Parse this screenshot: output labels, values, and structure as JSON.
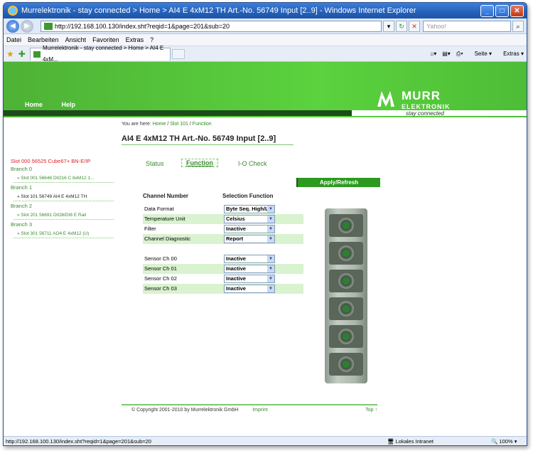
{
  "window": {
    "title": "Murrelektronik - stay connected > Home > AI4 E 4xM12 TH Art.-No. 56749 Input [2..9] - Windows Internet Explorer",
    "url": "http://192.168.100.130/index.sht?reqid=1&page=201&sub=20",
    "search_placeholder": "Yahoo!",
    "tab_title": "Murrelektronik - stay connected > Home > AI4 E 4xM...",
    "status_url": "http://192.168.100.130/index.sht?reqid=1&page=201&sub=20",
    "zone": "Lokales Intranet",
    "zoom": "100%"
  },
  "menu": [
    "Datei",
    "Bearbeiten",
    "Ansicht",
    "Favoriten",
    "Extras",
    "?"
  ],
  "commands": {
    "page": "Seite",
    "extras": "Extras"
  },
  "site": {
    "nav": [
      "Home",
      "Help"
    ],
    "logo_top": "MURR",
    "logo_bottom": "ELEKTRONIK",
    "slogan": "stay connected"
  },
  "breadcrumb": {
    "prefix": "You are here:",
    "home": "Home",
    "slot": "Slot 101",
    "page": "Function"
  },
  "page_title": "AI4 E 4xM12 TH Art.-No. 56749 Input [2..9]",
  "sidebar": {
    "slot0": "Slot 000 56525 Cube67+ BN-E/IP",
    "groups": [
      {
        "branch": "Branch 0",
        "item": "Slot 001 56646 DIO16 C 8xM12 1..."
      },
      {
        "branch": "Branch 1",
        "item": "Slot 101 56749 AI4 E 4xM12 TH"
      },
      {
        "branch": "Branch 2",
        "item": "Slot 201 56691 DIO8/DI8 E Rail"
      },
      {
        "branch": "Branch 3",
        "item": "Slot 301 56711 AO4 E 4xM12 (U)"
      }
    ]
  },
  "tabs": {
    "status": "Status",
    "function": "Function",
    "io_check": "I-O Check"
  },
  "apply_button": "Apply/Refresh",
  "table": {
    "col_channel": "Channel Number",
    "col_selection": "Selection Function",
    "rows": [
      {
        "label": "Data Format",
        "value": "Byte Seq. High/L"
      },
      {
        "label": "Temperature Unit",
        "value": "Celsius"
      },
      {
        "label": "Filter",
        "value": "Inactive"
      },
      {
        "label": "Channel Diagnostic",
        "value": "Report"
      },
      {
        "label": "Sensor Ch 00",
        "value": "Inactive"
      },
      {
        "label": "Sensor Ch 01",
        "value": "Inactive"
      },
      {
        "label": "Sensor Ch 02",
        "value": "Inactive"
      },
      {
        "label": "Sensor Ch 03",
        "value": "Inactive"
      }
    ]
  },
  "footer": {
    "copyright": "© Copyright 2001-2010 by Murrelektronik GmbH",
    "imprint": "Imprint",
    "top": "Top ↑"
  }
}
